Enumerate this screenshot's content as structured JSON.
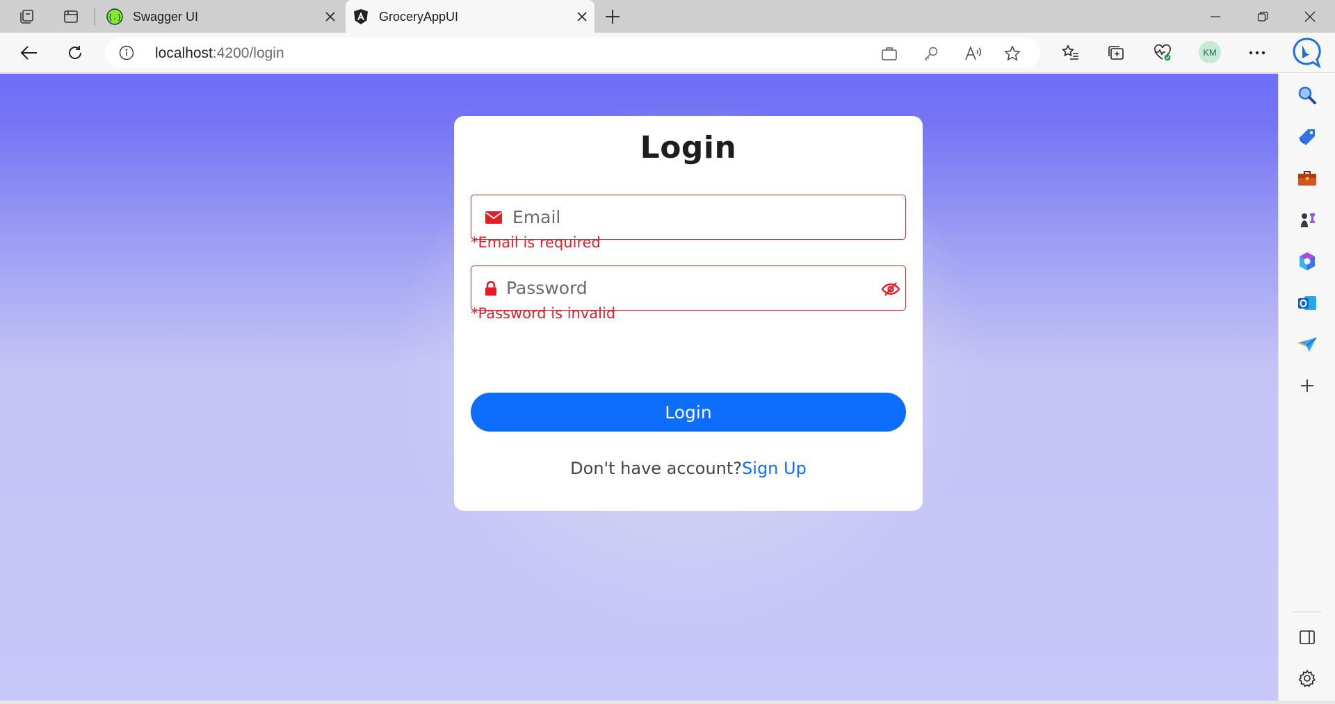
{
  "browser": {
    "tabs": [
      {
        "title": "Swagger UI",
        "favicon": "swagger-icon",
        "active": false
      },
      {
        "title": "GroceryAppUI",
        "favicon": "angular-icon",
        "active": true
      }
    ],
    "address": {
      "host": "localhost",
      "path": ":4200/login"
    },
    "profile_initials": "KM",
    "sidebar_icons": [
      "search-icon",
      "shopping-tag-icon",
      "tools-icon",
      "games-icon",
      "microsoft-365-icon",
      "outlook-icon",
      "send-icon",
      "add-icon",
      "sidebar-layout-icon",
      "settings-icon"
    ]
  },
  "login": {
    "title": "Login",
    "email_placeholder": "Email",
    "email_error": "*Email is required",
    "password_placeholder": "Password",
    "password_error": "*Password is invalid",
    "submit_label": "Login",
    "signup_prompt": "Don't have account?",
    "signup_link": "Sign Up"
  },
  "colors": {
    "accent": "#0d6efd",
    "error": "#d9232d",
    "background_top": "#6d6ef6",
    "background_bottom": "#c8c7fa"
  }
}
